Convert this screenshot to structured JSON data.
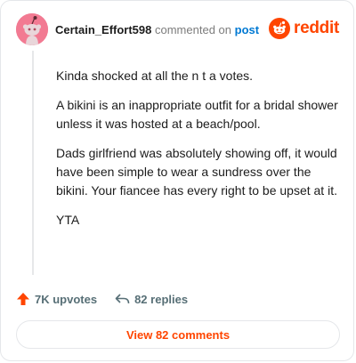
{
  "header": {
    "username": "Certain_Effort598",
    "action_text": "commented on",
    "link_text": "post",
    "brand": "reddit"
  },
  "comment": {
    "paragraphs": [
      "Kinda shocked at all the n t a votes.",
      "A bikini is an inappropriate outfit for a bridal shower unless it was hosted at a beach/pool.",
      "Dads girlfriend was absolutely showing off, it would have been simple to wear a sundress over the bikini. Your fiancee has every right to be upset at it.",
      "YTA"
    ]
  },
  "actions": {
    "upvotes": "7K upvotes",
    "replies": "82 replies"
  },
  "view_button": "View 82 comments",
  "colors": {
    "brand": "#ff4500",
    "link": "#0079d3",
    "avatar_bg": "#f27a92"
  },
  "icons": [
    "snoo-avatar-icon",
    "reddit-logo-icon",
    "upvote-arrow-icon",
    "reply-arrow-icon"
  ]
}
